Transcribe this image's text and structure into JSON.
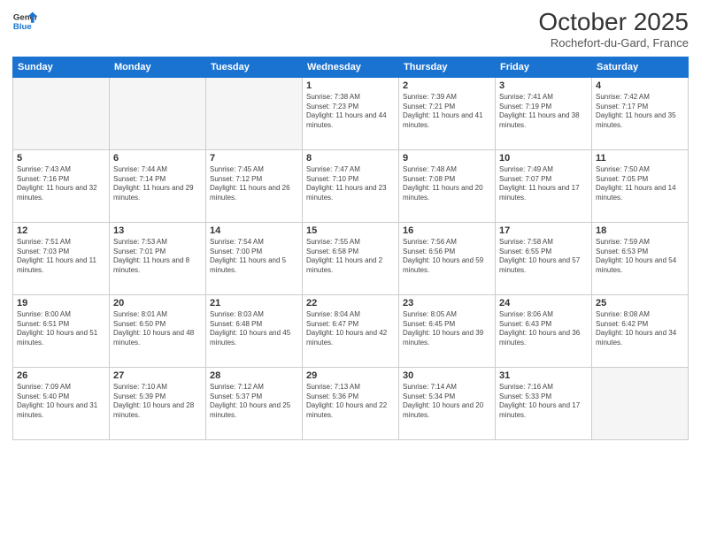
{
  "header": {
    "logo_line1": "General",
    "logo_line2": "Blue",
    "month": "October 2025",
    "location": "Rochefort-du-Gard, France"
  },
  "weekdays": [
    "Sunday",
    "Monday",
    "Tuesday",
    "Wednesday",
    "Thursday",
    "Friday",
    "Saturday"
  ],
  "weeks": [
    [
      {
        "day": "",
        "sunrise": "",
        "sunset": "",
        "daylight": ""
      },
      {
        "day": "",
        "sunrise": "",
        "sunset": "",
        "daylight": ""
      },
      {
        "day": "",
        "sunrise": "",
        "sunset": "",
        "daylight": ""
      },
      {
        "day": "1",
        "sunrise": "Sunrise: 7:38 AM",
        "sunset": "Sunset: 7:23 PM",
        "daylight": "Daylight: 11 hours and 44 minutes."
      },
      {
        "day": "2",
        "sunrise": "Sunrise: 7:39 AM",
        "sunset": "Sunset: 7:21 PM",
        "daylight": "Daylight: 11 hours and 41 minutes."
      },
      {
        "day": "3",
        "sunrise": "Sunrise: 7:41 AM",
        "sunset": "Sunset: 7:19 PM",
        "daylight": "Daylight: 11 hours and 38 minutes."
      },
      {
        "day": "4",
        "sunrise": "Sunrise: 7:42 AM",
        "sunset": "Sunset: 7:17 PM",
        "daylight": "Daylight: 11 hours and 35 minutes."
      }
    ],
    [
      {
        "day": "5",
        "sunrise": "Sunrise: 7:43 AM",
        "sunset": "Sunset: 7:16 PM",
        "daylight": "Daylight: 11 hours and 32 minutes."
      },
      {
        "day": "6",
        "sunrise": "Sunrise: 7:44 AM",
        "sunset": "Sunset: 7:14 PM",
        "daylight": "Daylight: 11 hours and 29 minutes."
      },
      {
        "day": "7",
        "sunrise": "Sunrise: 7:45 AM",
        "sunset": "Sunset: 7:12 PM",
        "daylight": "Daylight: 11 hours and 26 minutes."
      },
      {
        "day": "8",
        "sunrise": "Sunrise: 7:47 AM",
        "sunset": "Sunset: 7:10 PM",
        "daylight": "Daylight: 11 hours and 23 minutes."
      },
      {
        "day": "9",
        "sunrise": "Sunrise: 7:48 AM",
        "sunset": "Sunset: 7:08 PM",
        "daylight": "Daylight: 11 hours and 20 minutes."
      },
      {
        "day": "10",
        "sunrise": "Sunrise: 7:49 AM",
        "sunset": "Sunset: 7:07 PM",
        "daylight": "Daylight: 11 hours and 17 minutes."
      },
      {
        "day": "11",
        "sunrise": "Sunrise: 7:50 AM",
        "sunset": "Sunset: 7:05 PM",
        "daylight": "Daylight: 11 hours and 14 minutes."
      }
    ],
    [
      {
        "day": "12",
        "sunrise": "Sunrise: 7:51 AM",
        "sunset": "Sunset: 7:03 PM",
        "daylight": "Daylight: 11 hours and 11 minutes."
      },
      {
        "day": "13",
        "sunrise": "Sunrise: 7:53 AM",
        "sunset": "Sunset: 7:01 PM",
        "daylight": "Daylight: 11 hours and 8 minutes."
      },
      {
        "day": "14",
        "sunrise": "Sunrise: 7:54 AM",
        "sunset": "Sunset: 7:00 PM",
        "daylight": "Daylight: 11 hours and 5 minutes."
      },
      {
        "day": "15",
        "sunrise": "Sunrise: 7:55 AM",
        "sunset": "Sunset: 6:58 PM",
        "daylight": "Daylight: 11 hours and 2 minutes."
      },
      {
        "day": "16",
        "sunrise": "Sunrise: 7:56 AM",
        "sunset": "Sunset: 6:56 PM",
        "daylight": "Daylight: 10 hours and 59 minutes."
      },
      {
        "day": "17",
        "sunrise": "Sunrise: 7:58 AM",
        "sunset": "Sunset: 6:55 PM",
        "daylight": "Daylight: 10 hours and 57 minutes."
      },
      {
        "day": "18",
        "sunrise": "Sunrise: 7:59 AM",
        "sunset": "Sunset: 6:53 PM",
        "daylight": "Daylight: 10 hours and 54 minutes."
      }
    ],
    [
      {
        "day": "19",
        "sunrise": "Sunrise: 8:00 AM",
        "sunset": "Sunset: 6:51 PM",
        "daylight": "Daylight: 10 hours and 51 minutes."
      },
      {
        "day": "20",
        "sunrise": "Sunrise: 8:01 AM",
        "sunset": "Sunset: 6:50 PM",
        "daylight": "Daylight: 10 hours and 48 minutes."
      },
      {
        "day": "21",
        "sunrise": "Sunrise: 8:03 AM",
        "sunset": "Sunset: 6:48 PM",
        "daylight": "Daylight: 10 hours and 45 minutes."
      },
      {
        "day": "22",
        "sunrise": "Sunrise: 8:04 AM",
        "sunset": "Sunset: 6:47 PM",
        "daylight": "Daylight: 10 hours and 42 minutes."
      },
      {
        "day": "23",
        "sunrise": "Sunrise: 8:05 AM",
        "sunset": "Sunset: 6:45 PM",
        "daylight": "Daylight: 10 hours and 39 minutes."
      },
      {
        "day": "24",
        "sunrise": "Sunrise: 8:06 AM",
        "sunset": "Sunset: 6:43 PM",
        "daylight": "Daylight: 10 hours and 36 minutes."
      },
      {
        "day": "25",
        "sunrise": "Sunrise: 8:08 AM",
        "sunset": "Sunset: 6:42 PM",
        "daylight": "Daylight: 10 hours and 34 minutes."
      }
    ],
    [
      {
        "day": "26",
        "sunrise": "Sunrise: 7:09 AM",
        "sunset": "Sunset: 5:40 PM",
        "daylight": "Daylight: 10 hours and 31 minutes."
      },
      {
        "day": "27",
        "sunrise": "Sunrise: 7:10 AM",
        "sunset": "Sunset: 5:39 PM",
        "daylight": "Daylight: 10 hours and 28 minutes."
      },
      {
        "day": "28",
        "sunrise": "Sunrise: 7:12 AM",
        "sunset": "Sunset: 5:37 PM",
        "daylight": "Daylight: 10 hours and 25 minutes."
      },
      {
        "day": "29",
        "sunrise": "Sunrise: 7:13 AM",
        "sunset": "Sunset: 5:36 PM",
        "daylight": "Daylight: 10 hours and 22 minutes."
      },
      {
        "day": "30",
        "sunrise": "Sunrise: 7:14 AM",
        "sunset": "Sunset: 5:34 PM",
        "daylight": "Daylight: 10 hours and 20 minutes."
      },
      {
        "day": "31",
        "sunrise": "Sunrise: 7:16 AM",
        "sunset": "Sunset: 5:33 PM",
        "daylight": "Daylight: 10 hours and 17 minutes."
      },
      {
        "day": "",
        "sunrise": "",
        "sunset": "",
        "daylight": ""
      }
    ]
  ]
}
